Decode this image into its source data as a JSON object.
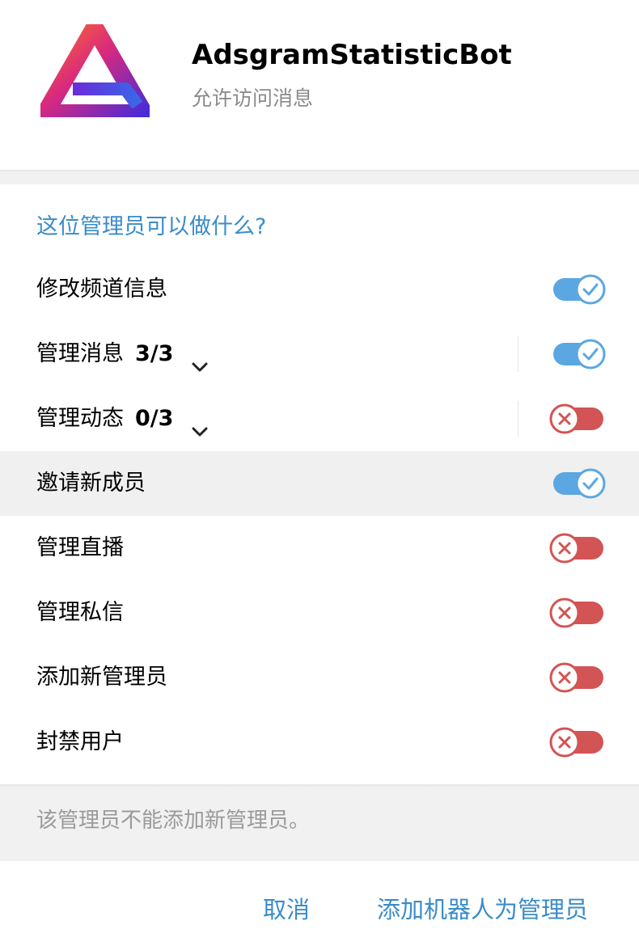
{
  "header": {
    "bot_name": "AdsgramStatisticBot",
    "bot_status": "允许访问消息"
  },
  "section_title": "这位管理员可以做什么?",
  "permissions": [
    {
      "label": "修改频道信息",
      "count": "",
      "enabled": true,
      "expandable": false
    },
    {
      "label": "管理消息",
      "count": "3/3",
      "enabled": true,
      "expandable": true
    },
    {
      "label": "管理动态",
      "count": "0/3",
      "enabled": false,
      "expandable": true
    },
    {
      "label": "邀请新成员",
      "count": "",
      "enabled": true,
      "expandable": false
    },
    {
      "label": "管理直播",
      "count": "",
      "enabled": false,
      "expandable": false
    },
    {
      "label": "管理私信",
      "count": "",
      "enabled": false,
      "expandable": false
    },
    {
      "label": "添加新管理员",
      "count": "",
      "enabled": false,
      "expandable": false
    },
    {
      "label": "封禁用户",
      "count": "",
      "enabled": false,
      "expandable": false
    }
  ],
  "footer_note": "该管理员不能添加新管理员。",
  "actions": {
    "cancel_label": "取消",
    "confirm_label": "添加机器人为管理员"
  },
  "colors": {
    "accent": "#3a8cc9",
    "toggle_on": "#5aa7e2",
    "toggle_off": "#d35454"
  }
}
